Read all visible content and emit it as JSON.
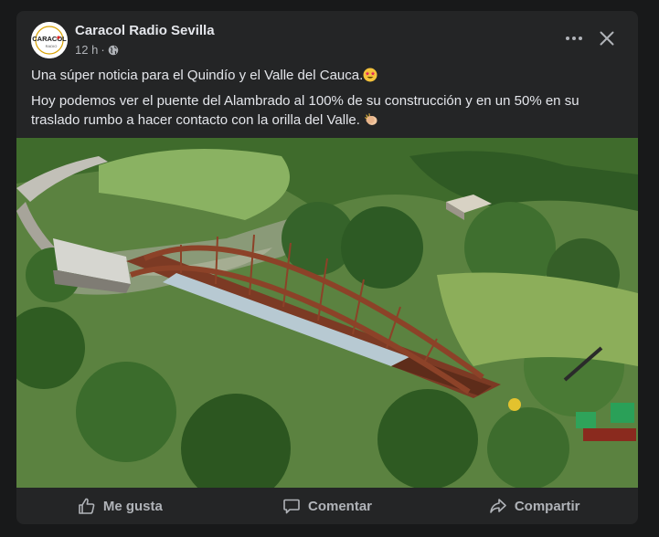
{
  "post": {
    "author": "Caracol Radio Sevilla",
    "time": "12 h",
    "separator": "·",
    "avatar_logo_text": "CARACOL",
    "avatar_logo_subtext": "RADIO",
    "line1": "Una súper noticia para el Quindío y el Valle del Cauca.",
    "line2": "Hoy podemos ver el puente del Alambrado al 100% de su construcción y en un 50% en su traslado rumbo a hacer contacto con la orilla del Valle.",
    "photo_alt": "Vista aérea del puente del Alambrado"
  },
  "icons": {
    "audience": "globe-icon",
    "more": "more-options-icon",
    "close": "close-icon",
    "like": "thumbs-up-icon",
    "comment": "comment-icon",
    "share": "share-icon",
    "emoji1": "star-struck-emoji",
    "emoji2": "clapping-hands-emoji"
  },
  "actions": {
    "like": "Me gusta",
    "comment": "Comentar",
    "share": "Compartir"
  },
  "colors": {
    "background": "#18191a",
    "card": "#242526",
    "primary_text": "#e4e6eb",
    "secondary_text": "#b0b3b8"
  }
}
